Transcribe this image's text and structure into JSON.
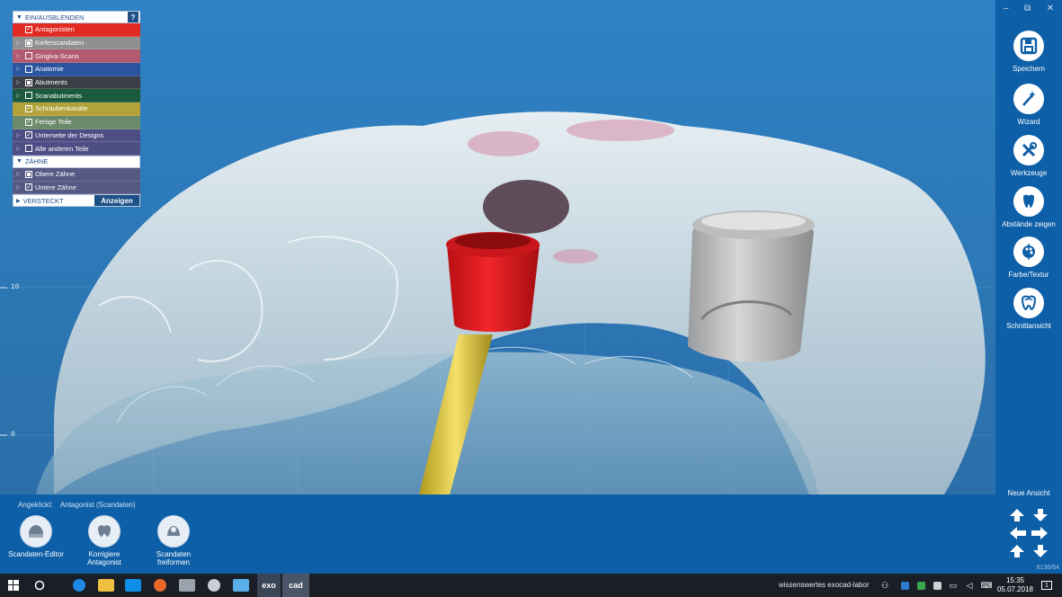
{
  "visibility_panel": {
    "header": "EIN/AUSBLENDEN",
    "help_label": "?",
    "rows": [
      {
        "label": "Antagonisten",
        "checked": "check",
        "color": "#e02a22",
        "arrow": false
      },
      {
        "label": "Kieferscandaten",
        "checked": "partial",
        "color": "#8e9092",
        "arrow": true
      },
      {
        "label": "Gingiva-Scans",
        "checked": "none",
        "color": "#b35a6e",
        "arrow": true
      },
      {
        "label": "Anatomie",
        "checked": "none",
        "color": "#2a54a0",
        "arrow": true
      },
      {
        "label": "Abutments",
        "checked": "partial",
        "color": "#3b3e45",
        "arrow": true
      },
      {
        "label": "Scanabutments",
        "checked": "none",
        "color": "#1b5a3c",
        "arrow": true
      },
      {
        "label": "Schraubenkanäle",
        "checked": "check",
        "color": "#b3a23a",
        "arrow": false
      },
      {
        "label": "Fertige Teile",
        "checked": "check",
        "color": "#6a8a6a",
        "arrow": false
      },
      {
        "label": "Unterseite der Designs",
        "checked": "check",
        "color": "#4e4e85",
        "arrow": true
      },
      {
        "label": "Alle anderen Teile",
        "checked": "none",
        "color": "#4e4e85",
        "arrow": true
      }
    ],
    "section2_header": "ZÄHNE",
    "section2_rows": [
      {
        "label": "Obere Zähne",
        "checked": "partial",
        "color": "#555a85",
        "arrow": true
      },
      {
        "label": "Untere Zähne",
        "checked": "check",
        "color": "#555a85",
        "arrow": true
      }
    ],
    "footer_label": "VERSTECKT",
    "footer_button": "Anzeigen"
  },
  "ruler": {
    "tick_upper": "10",
    "tick_lower": "0"
  },
  "right_bar": {
    "window_controls": [
      "–",
      "⧉",
      "✕"
    ],
    "tools": [
      {
        "label": "Speichern",
        "icon": "save-icon"
      },
      {
        "label": "Wizard",
        "icon": "magic-wand-icon"
      },
      {
        "label": "Werkzeuge",
        "icon": "tools-icon"
      },
      {
        "label": "Abstände zeigen",
        "icon": "distance-icon"
      },
      {
        "label": "Farbe/Textur",
        "icon": "palette-icon"
      },
      {
        "label": "Schnittansicht",
        "icon": "cross-section-icon"
      }
    ],
    "neue_ansicht": "Neue Ansicht",
    "version": "6136/64"
  },
  "bottom_panel": {
    "angeklickt_label": "Angeklickt:",
    "angeklickt_value": "Antagonist (Scandaten)",
    "buttons": [
      {
        "label": "Scandaten-Editor",
        "icon": "scan-editor-icon"
      },
      {
        "label": "Korrigiere Antagonist",
        "icon": "correct-antagonist-icon"
      },
      {
        "label": "Scandaten freiformen",
        "icon": "freeform-icon"
      }
    ]
  },
  "taskbar": {
    "exo_label": "exo",
    "cad_label": "cad",
    "tray_text": "wissenswertes exocad-labor",
    "time": "15:35",
    "date": "05.07.2018",
    "notification_count": "1"
  }
}
